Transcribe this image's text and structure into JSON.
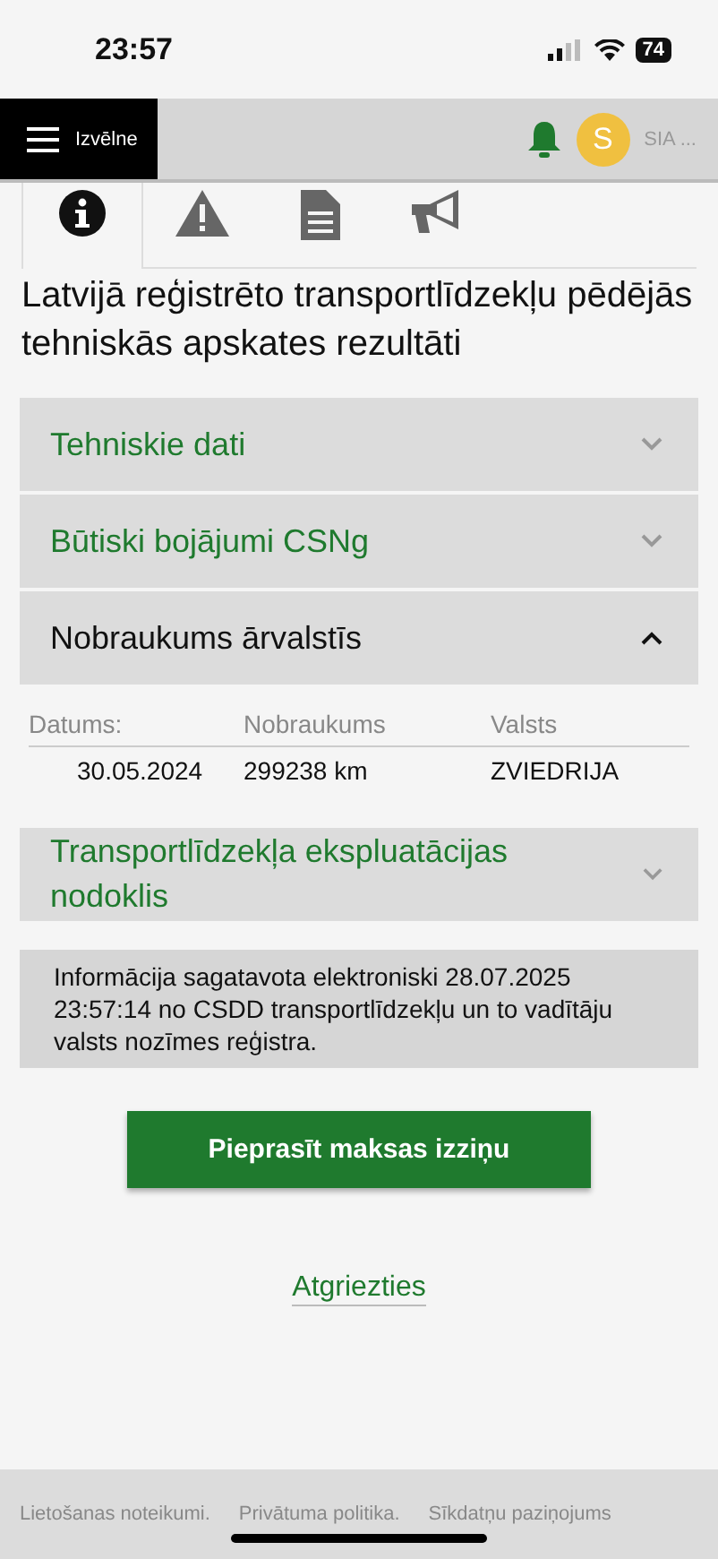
{
  "status_bar": {
    "time": "23:57",
    "battery": "74"
  },
  "header": {
    "menu_label": "Izvēlne",
    "avatar_letter": "S",
    "account": "SIA ..."
  },
  "tabs": [
    {
      "kind": "info",
      "selected": true
    },
    {
      "kind": "warning",
      "selected": false
    },
    {
      "kind": "document",
      "selected": false
    },
    {
      "kind": "megaphone",
      "selected": false
    }
  ],
  "title": "Latvijā reģistrēto transportlīdzekļu pēdējās tehniskās apskates rezultāti",
  "sections": [
    {
      "title": "Tehniskie dati",
      "expanded": false
    },
    {
      "title": "Būtiski bojājumi CSNg",
      "expanded": false
    },
    {
      "title": "Nobraukums ārvalstīs",
      "expanded": true,
      "table": {
        "columns": [
          "Datums:",
          "Nobraukums",
          "Valsts"
        ],
        "rows": [
          [
            "30.05.2024",
            "299238 km",
            "ZVIEDRIJA"
          ]
        ]
      }
    },
    {
      "title": "Transportlīdzekļa ekspluatācijas nodoklis",
      "expanded": false
    }
  ],
  "info": "Informācija sagatavota elektroniski 28.07.2025 23:57:14 no CSDD transportlīdzekļu un to vadītāju valsts nozīmes reģistra.",
  "request_button": "Pieprasīt maksas izziņu",
  "back_link": "Atgriezties",
  "footer_links": [
    "Lietošanas noteikumi.",
    "Privātuma politika.",
    "Sīkdatņu paziņojums"
  ]
}
